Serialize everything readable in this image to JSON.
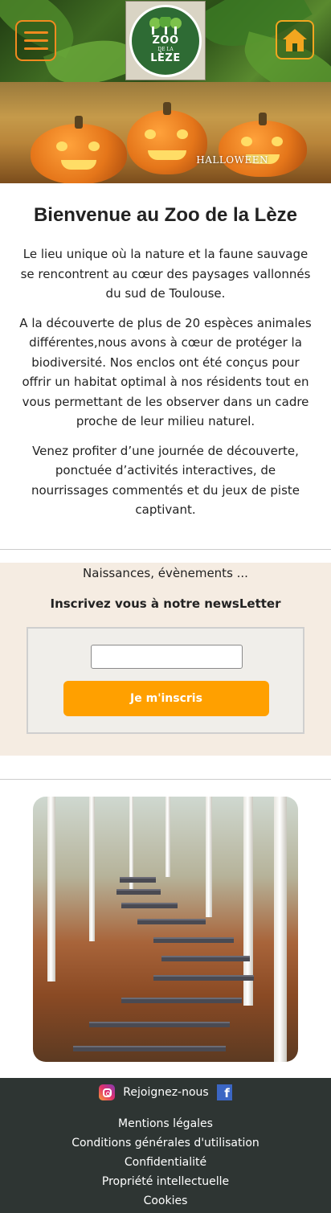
{
  "header": {
    "menu_icon": "hamburger-menu-icon",
    "logo_text_main": "ZOO",
    "logo_text_small": "DE LA",
    "logo_text_name": "LÈZE",
    "home_icon": "home-icon",
    "accent_color": "#f28a1f"
  },
  "banner": {
    "caption": "HALLOWEEN"
  },
  "intro": {
    "title": "Bienvenue au Zoo de la Lèze",
    "paragraphs": [
      "Le lieu unique où la nature et la faune sauvage se rencontrent au cœur des paysages vallonnés du sud de Toulouse.",
      "A la découverte de plus de 20 espèces animales différentes,nous avons à cœur de protéger la biodiversité. Nos enclos ont été conçus pour offrir un habitat optimal à nos résidents tout en vous permettant de les observer dans un cadre proche de leur milieu naturel.",
      "Venez profiter d’une journée de découverte, ponctuée d’activités interactives, de nourrissages commentés et du jeux de piste captivant."
    ]
  },
  "newsletter": {
    "kicker": "Naissances, évènements ...",
    "title": "Inscrivez vous à notre newsLetter",
    "email_value": "",
    "button_label": "Je m'inscris",
    "button_color": "#ffa000",
    "background_color": "#f5ece2"
  },
  "footer": {
    "social_label": "Rejoignez-nous",
    "instagram_icon": "instagram-icon",
    "facebook_icon": "facebook-icon",
    "facebook_glyph": "f",
    "links": [
      "Mentions légales",
      "Conditions générales d'utilisation",
      "Confidentialité",
      "Propriété intellectuelle",
      "Cookies"
    ],
    "background_color": "#2e3533"
  }
}
